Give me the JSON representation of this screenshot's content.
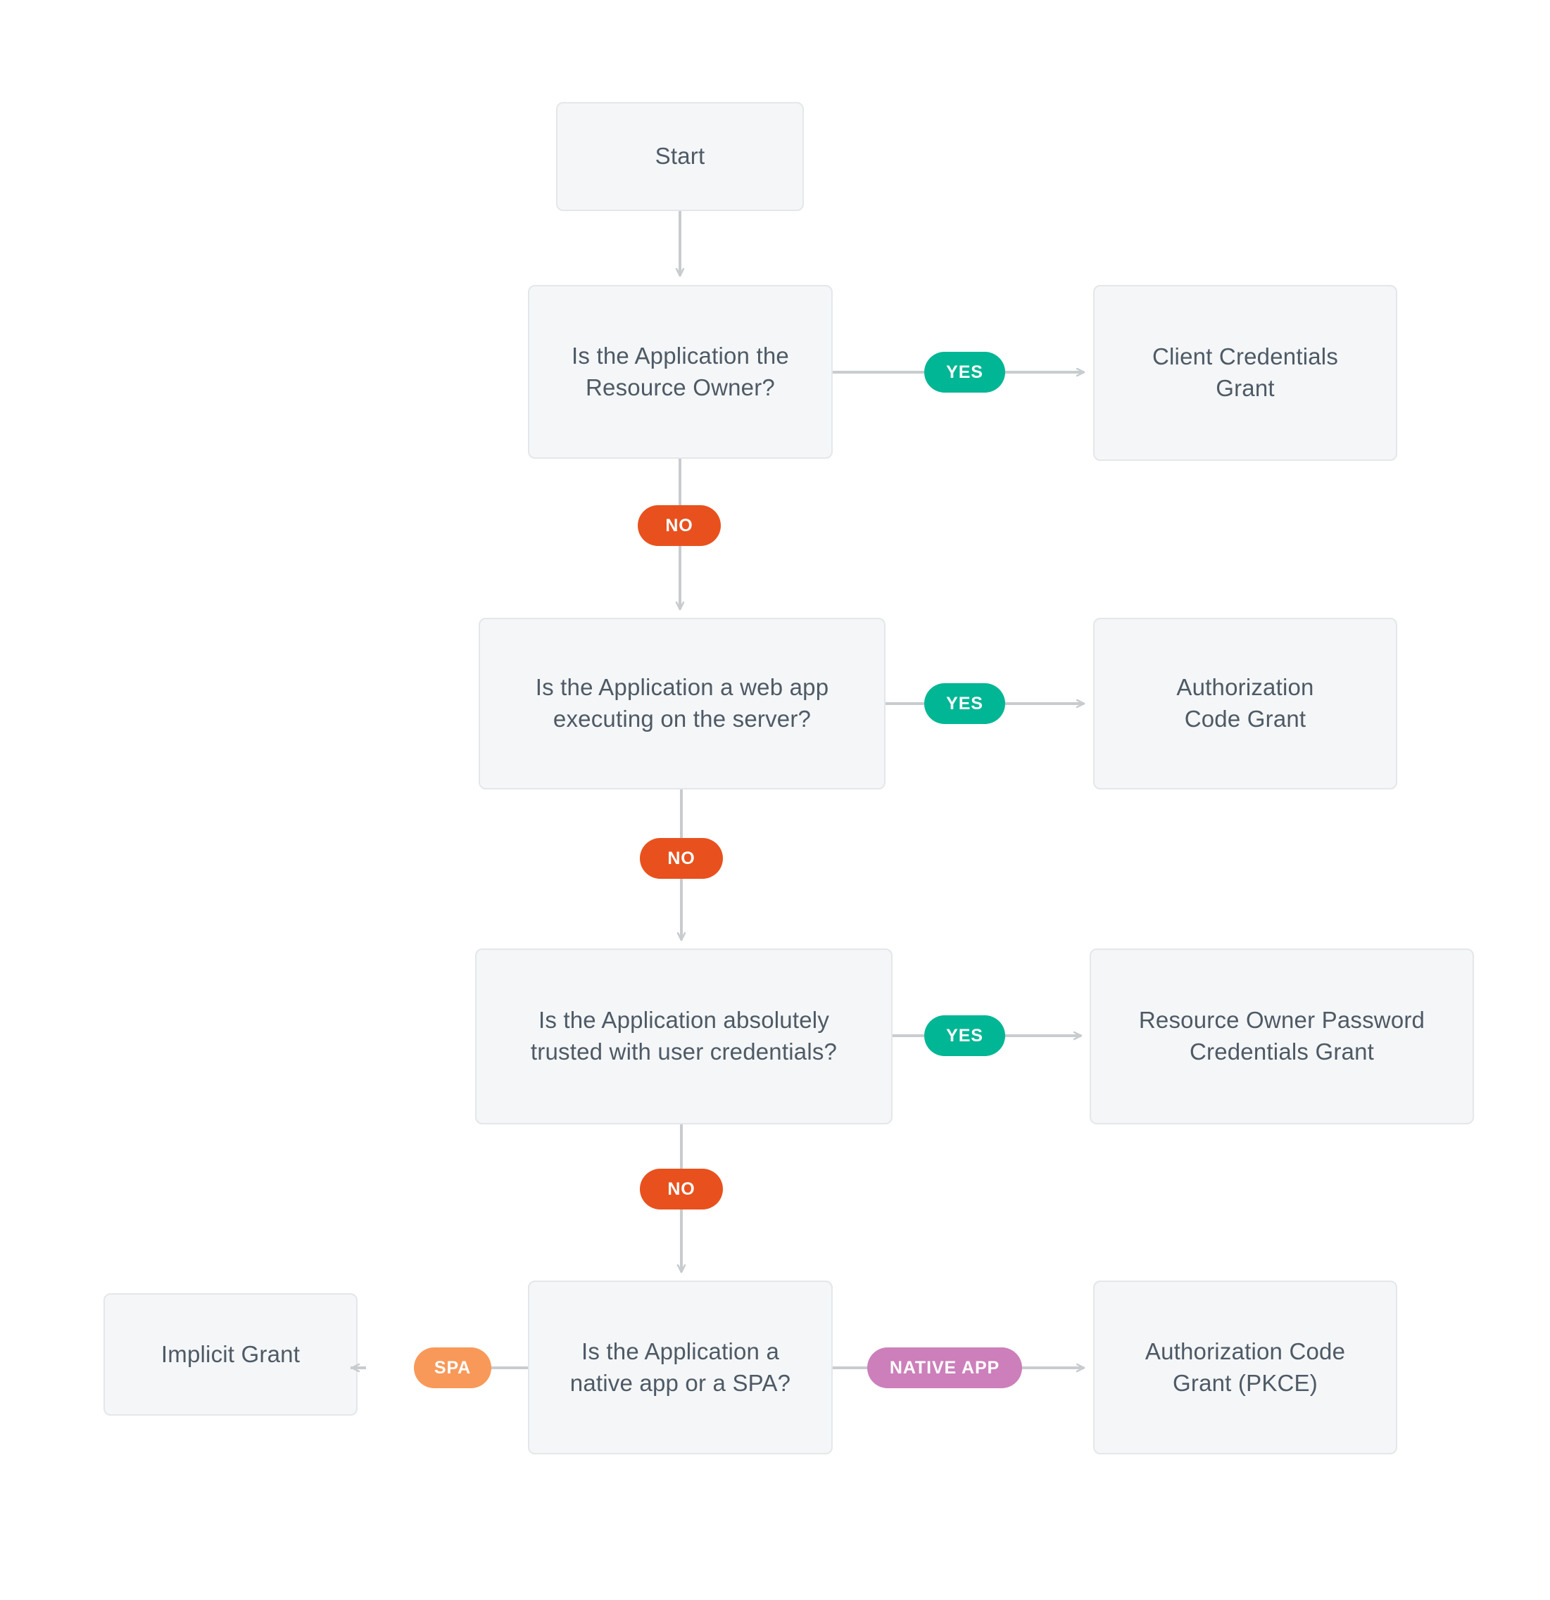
{
  "diagram": {
    "title": "OAuth 2.0 Grant Type Decision Flowchart",
    "background_color": "#ffffff",
    "node_fill_color": "#f4f6f8",
    "node_border_color": "#e4e7e9",
    "node_text_color": "#4e5a65",
    "connector_color": "#c8cccf"
  },
  "nodes": {
    "start": {
      "label": "Start"
    },
    "decision_1": {
      "label": "Is the Application the\nResource Owner?"
    },
    "outcome_1": {
      "label": "Client Credentials\nGrant"
    },
    "decision_2": {
      "label": "Is the Application a web app\nexecuting on the server?"
    },
    "outcome_2": {
      "label": "Authorization\nCode Grant"
    },
    "decision_3": {
      "label": "Is the Application absolutely\ntrusted with user credentials?"
    },
    "outcome_3": {
      "label": "Resource Owner Password\nCredentials Grant"
    },
    "decision_4": {
      "label": "Is the Application a\nnative app or a SPA?"
    },
    "outcome_4_left": {
      "label": "Implicit Grant"
    },
    "outcome_4_right": {
      "label": "Authorization Code\nGrant (PKCE)"
    }
  },
  "edge_labels": {
    "yes_1": {
      "text": "YES",
      "color": "#00b694"
    },
    "no_1": {
      "text": "NO",
      "color": "#e8511e"
    },
    "yes_2": {
      "text": "YES",
      "color": "#00b694"
    },
    "no_2": {
      "text": "NO",
      "color": "#e8511e"
    },
    "yes_3": {
      "text": "YES",
      "color": "#00b694"
    },
    "no_3": {
      "text": "NO",
      "color": "#e8511e"
    },
    "spa": {
      "text": "SPA",
      "color": "#f8995a"
    },
    "native_app": {
      "text": "NATIVE APP",
      "color": "#cc7fba"
    }
  }
}
